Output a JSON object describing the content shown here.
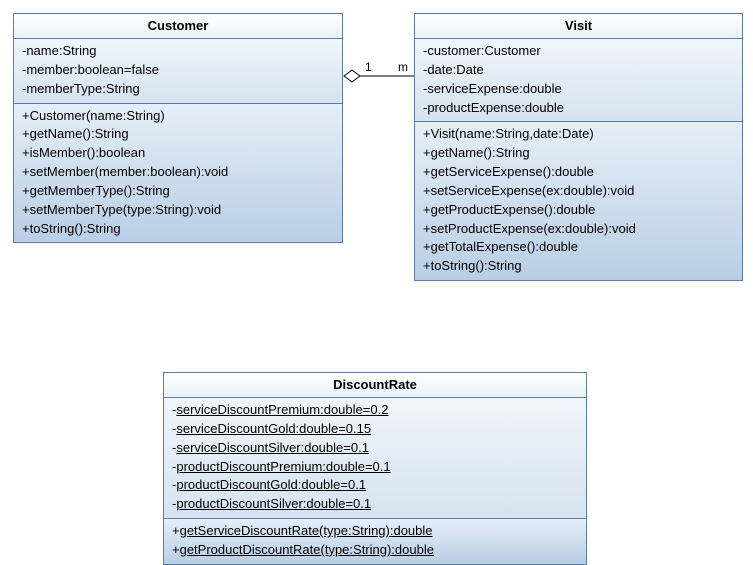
{
  "classes": {
    "customer": {
      "name": "Customer",
      "attrs": [
        "-name:String",
        "-member:boolean=false",
        "-memberType:String"
      ],
      "ops": [
        "+Customer(name:String)",
        "+getName():String",
        "+isMember():boolean",
        "+setMember(member:boolean):void",
        "+getMemberType():String",
        "+setMemberType(type:String):void",
        "+toString():String"
      ]
    },
    "visit": {
      "name": "Visit",
      "attrs": [
        "-customer:Customer",
        "-date:Date",
        "-serviceExpense:double",
        "-productExpense:double"
      ],
      "ops": [
        "+Visit(name:String,date:Date)",
        "+getName():String",
        "+getServiceExpense():double",
        "+setServiceExpense(ex:double):void",
        "+getProductExpense():double",
        "+setProductExpense(ex:double):void",
        "+getTotalExpense():double",
        "+toString():String"
      ]
    },
    "discount": {
      "name": "DiscountRate",
      "attrs": [
        {
          "text": "-serviceDiscountPremium:double=0.2",
          "static": true
        },
        {
          "text": "-serviceDiscountGold:double=0.15",
          "static": true
        },
        {
          "text": "-serviceDiscountSilver:double=0.1",
          "static": true
        },
        {
          "text": "-productDiscountPremium:double=0.1",
          "static": true
        },
        {
          "text": "-productDiscountGold:double=0.1",
          "static": true
        },
        {
          "text": "-productDiscountSilver:double=0.1",
          "static": true
        }
      ],
      "ops": [
        {
          "text": "+getServiceDiscountRate(type:String):double",
          "static": true
        },
        {
          "text": "+getProductDiscountRate(type:String):double",
          "static": true
        }
      ]
    }
  },
  "relation": {
    "left_mult": "1",
    "right_mult": "m",
    "type": "aggregation"
  }
}
